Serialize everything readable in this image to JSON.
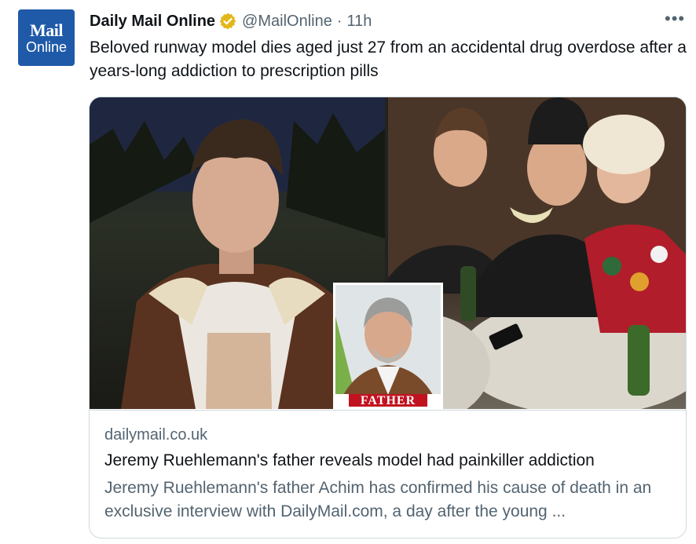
{
  "avatar": {
    "line1": "Mail",
    "line2": "Online"
  },
  "header": {
    "name": "Daily Mail Online",
    "handle": "@MailOnline",
    "separator": "·",
    "time": "11h",
    "more": "•••"
  },
  "tweet": {
    "text": "Beloved runway model dies aged just 27 from an accidental drug overdose after a years-long addiction to prescription pills"
  },
  "card": {
    "inset_label": "FATHER",
    "domain": "dailymail.co.uk",
    "title": "Jeremy Ruehlemann's father reveals model had painkiller addiction",
    "description": "Jeremy Ruehlemann's father Achim has confirmed his cause of death in an exclusive interview with DailyMail.com, a day after the young ..."
  },
  "colors": {
    "brand_blue": "#1f5aa8",
    "verified_gold": "#e2b719",
    "secondary_text": "#536471",
    "border": "#cfd9de"
  }
}
